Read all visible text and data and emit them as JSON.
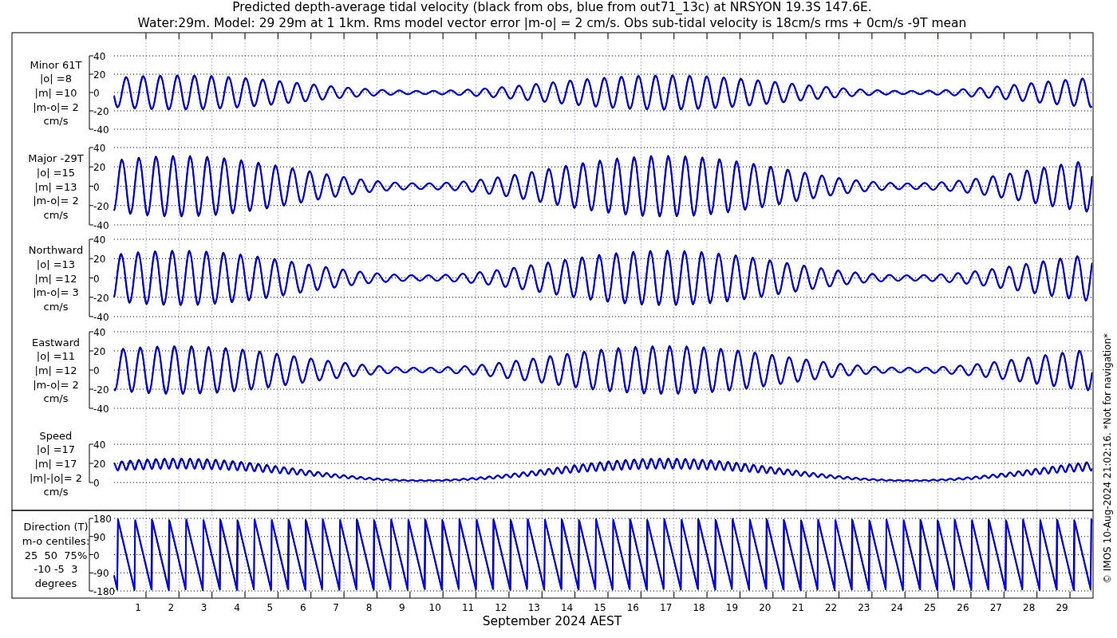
{
  "title_lines": [
    "Predicted depth-average tidal velocity (black from obs, blue from out71_13c) at NRSYON 19.3S 147.6E.",
    "Water:29m. Model: 29 29m at 1 1km. Rms model vector error |m-o| = 2 cm/s. Obs sub-tidal velocity is 18cm/s rms + 0cm/s -9T mean"
  ],
  "panels": [
    {
      "kind": "minor",
      "label_lines": [
        "Minor 61T",
        "|o| =8",
        "|m| =10",
        "|m-o|= 2",
        "cm/s"
      ],
      "yticks": [
        "40",
        "20",
        "0",
        "-20",
        "-40"
      ]
    },
    {
      "kind": "major",
      "label_lines": [
        "Major -29T",
        "|o| =15",
        "|m| =13",
        "|m-o|= 2",
        "cm/s"
      ],
      "yticks": [
        "40",
        "20",
        "0",
        "-20",
        "-40"
      ]
    },
    {
      "kind": "north",
      "label_lines": [
        "Northward",
        "|o| =13",
        "|m| =12",
        "|m-o|= 3",
        "cm/s"
      ],
      "yticks": [
        "40",
        "20",
        "0",
        "-20",
        "-40"
      ]
    },
    {
      "kind": "east",
      "label_lines": [
        "Eastward",
        "|o| =11",
        "|m| =12",
        "|m-o|= 2",
        "cm/s"
      ],
      "yticks": [
        "40",
        "20",
        "0",
        "-20",
        "-40"
      ]
    },
    {
      "kind": "speed",
      "label_lines": [
        "Speed",
        "|o| =17",
        "|m| =17",
        "|m|-|o|= 2",
        "cm/s"
      ],
      "yticks": [
        "40",
        "20",
        "0"
      ]
    },
    {
      "kind": "direction",
      "label_lines": [
        "Direction (T)",
        "m-o centiles:",
        "25  50  75%",
        "-10 -5  3",
        "degrees"
      ],
      "yticks": [
        "180",
        "90",
        "0",
        "-90",
        "-180"
      ]
    }
  ],
  "x_days": [
    "1",
    "2",
    "3",
    "4",
    "5",
    "6",
    "7",
    "8",
    "9",
    "10",
    "11",
    "12",
    "13",
    "14",
    "15",
    "16",
    "17",
    "18",
    "19",
    "20",
    "21",
    "22",
    "23",
    "24",
    "25",
    "26",
    "27",
    "28",
    "29"
  ],
  "x_label": "September 2024 AEST",
  "side_note": "© IMOS 10-Aug-2024 21:02:16. *Not for navigation*"
}
